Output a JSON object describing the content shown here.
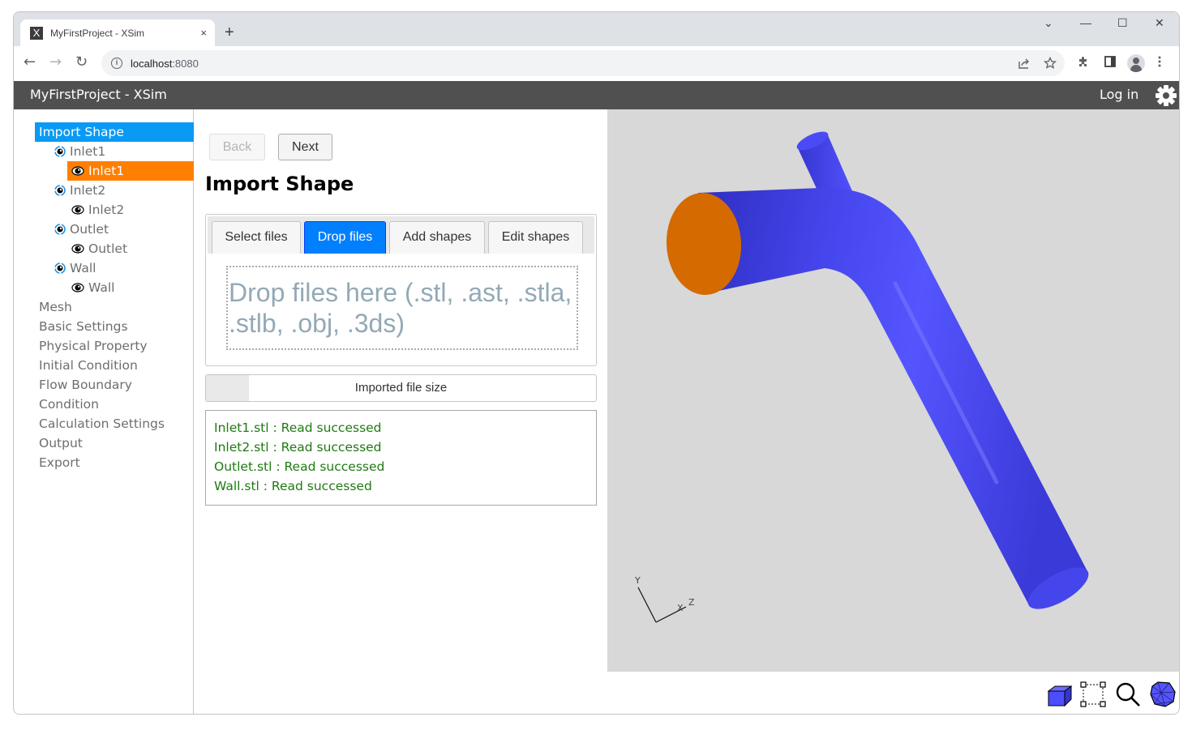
{
  "browser": {
    "tab_title": "MyFirstProject - XSim",
    "favicon_letter": "X",
    "tab_close": "×",
    "new_tab": "+",
    "url_host": "localhost",
    "url_port": ":8080",
    "window_controls": {
      "dropdown": "⌄",
      "minimize": "—",
      "maximize": "☐",
      "close": "✕"
    },
    "nav": {
      "back": "←",
      "forward": "→",
      "reload": "↻"
    }
  },
  "app": {
    "title": "MyFirstProject - XSim",
    "login_label": "Log in",
    "settings_icon": "gear-icon"
  },
  "sidebar": {
    "current_step": "Import Shape",
    "shapes": [
      {
        "group": "Inlet1",
        "leaf": "Inlet1",
        "selected": true
      },
      {
        "group": "Inlet2",
        "leaf": "Inlet2",
        "selected": false
      },
      {
        "group": "Outlet",
        "leaf": "Outlet",
        "selected": false
      },
      {
        "group": "Wall",
        "leaf": "Wall",
        "selected": false
      }
    ],
    "steps": [
      "Mesh",
      "Basic Settings",
      "Physical Property",
      "Initial Condition",
      "Flow Boundary",
      "Condition",
      "Calculation Settings",
      "Output",
      "Export"
    ]
  },
  "main": {
    "back_label": "Back",
    "next_label": "Next",
    "title": "Import Shape",
    "tabs": [
      {
        "label": "Select files",
        "active": false
      },
      {
        "label": "Drop files",
        "active": true
      },
      {
        "label": "Add shapes",
        "active": false
      },
      {
        "label": "Edit shapes",
        "active": false
      }
    ],
    "dropzone_text": "Drop files here (.stl, .ast, .stla, .stlb, .obj, .3ds)",
    "progress": {
      "label": "Imported file size",
      "fraction": 0.11
    },
    "log": [
      "Inlet1.stl : Read successed",
      "Inlet2.stl : Read successed",
      "Outlet.stl : Read successed",
      "Wall.stl : Read successed"
    ]
  },
  "viewport": {
    "axes": {
      "y": "Y",
      "x": "X",
      "z": "Z"
    },
    "colors": {
      "background": "#d8d8d8",
      "wall": "#4a4af0",
      "selected_face": "#d46a00"
    }
  },
  "bottom_tools": [
    {
      "name": "solid-view-icon"
    },
    {
      "name": "box-select-icon"
    },
    {
      "name": "zoom-icon"
    },
    {
      "name": "wireframe-view-icon"
    }
  ],
  "colors": {
    "active_step": "#0a9af4",
    "selected_shape": "#ff7f00",
    "active_tab": "#007fff",
    "log_text": "#1f7a12",
    "appbar": "#505050"
  }
}
